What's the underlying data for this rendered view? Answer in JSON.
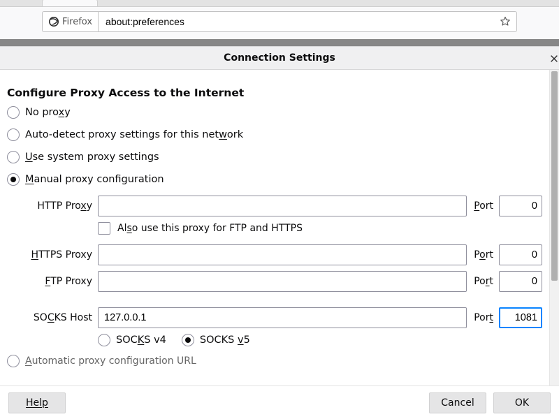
{
  "browser": {
    "identity_label": "Firefox",
    "url": "about:preferences"
  },
  "dialog": {
    "title": "Connection Settings",
    "section_heading": "Configure Proxy Access to the Internet",
    "radios": {
      "no_proxy": {
        "pre": "No pro",
        "u": "x",
        "post": "y"
      },
      "auto_detect": {
        "pre": "Auto-detect proxy settings for this net",
        "u": "w",
        "post": "ork"
      },
      "system": {
        "pre": "",
        "u": "U",
        "post": "se system proxy settings"
      },
      "manual": {
        "pre": "",
        "u": "M",
        "post": "anual proxy configuration"
      },
      "auto_url": {
        "pre": "",
        "u": "A",
        "post": "utomatic proxy configuration URL"
      }
    },
    "fields": {
      "http": {
        "label_pre": "HTTP Pro",
        "label_u": "x",
        "label_post": "y",
        "value": "",
        "port_pre": "",
        "port_u": "P",
        "port_post": "ort",
        "port_value": "0"
      },
      "also_use": {
        "pre": "Al",
        "u": "s",
        "post": "o use this proxy for FTP and HTTPS"
      },
      "https": {
        "label_pre": "",
        "label_u": "H",
        "label_post": "TTPS Proxy",
        "value": "",
        "port_pre": "P",
        "port_u": "o",
        "port_post": "rt",
        "port_value": "0"
      },
      "ftp": {
        "label_pre": "",
        "label_u": "F",
        "label_post": "TP Proxy",
        "value": "",
        "port_pre": "Po",
        "port_u": "r",
        "port_post": "t",
        "port_value": "0"
      },
      "socks": {
        "label_pre": "SO",
        "label_u": "C",
        "label_post": "KS Host",
        "value": "127.0.0.1",
        "port_pre": "Por",
        "port_u": "t",
        "port_post": "",
        "port_value": "1081"
      },
      "socks_v4": {
        "pre": "SOC",
        "u": "K",
        "post": "S v4"
      },
      "socks_v5": {
        "pre": "SOCKS ",
        "u": "v",
        "post": "5"
      }
    },
    "buttons": {
      "help": "Help",
      "cancel": "Cancel",
      "ok": "OK"
    }
  }
}
